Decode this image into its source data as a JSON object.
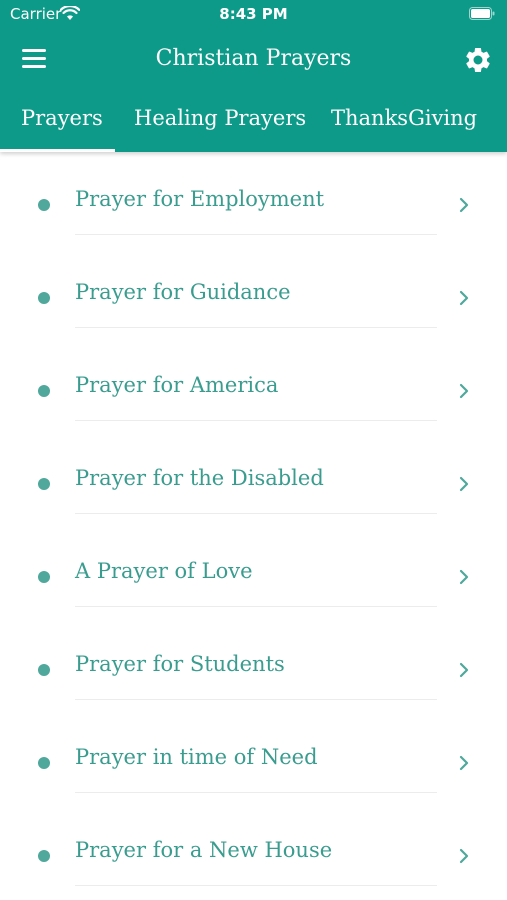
{
  "status": {
    "carrier": "Carrier",
    "time": "8:43 PM"
  },
  "nav": {
    "title": "Christian Prayers",
    "menu_icon": "hamburger-menu-icon",
    "settings_icon": "gear-icon"
  },
  "tabs": [
    {
      "label": "Prayers",
      "active": true
    },
    {
      "label": "Healing Prayers",
      "active": false
    },
    {
      "label": "ThanksGiving",
      "active": false
    }
  ],
  "prayers": [
    {
      "label": "Prayer for Employment"
    },
    {
      "label": "Prayer for Guidance"
    },
    {
      "label": "Prayer for America"
    },
    {
      "label": "Prayer for the Disabled"
    },
    {
      "label": "A Prayer of Love"
    },
    {
      "label": "Prayer for Students"
    },
    {
      "label": "Prayer in time of Need"
    },
    {
      "label": "Prayer for a New House"
    }
  ],
  "colors": {
    "primary": "#0e9a89",
    "accent_text": "#3a9c8f",
    "bullet": "#4fa89b"
  }
}
